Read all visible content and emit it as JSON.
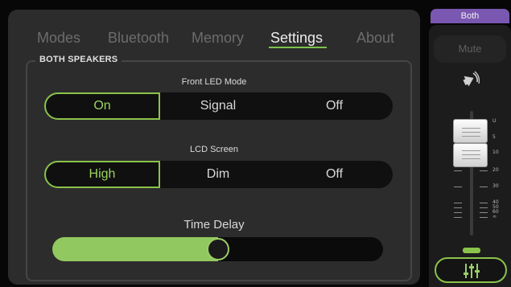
{
  "tabs": [
    {
      "label": "Modes",
      "active": false
    },
    {
      "label": "Bluetooth",
      "active": false
    },
    {
      "label": "Memory",
      "active": false
    },
    {
      "label": "Settings",
      "active": true
    },
    {
      "label": "About",
      "active": false
    }
  ],
  "group_title": "BOTH SPEAKERS",
  "front_led": {
    "label": "Front LED Mode",
    "options": [
      "On",
      "Signal",
      "Off"
    ],
    "selected": "On"
  },
  "lcd_screen": {
    "label": "LCD Screen",
    "options": [
      "High",
      "Dim",
      "Off"
    ],
    "selected": "High"
  },
  "time_delay": {
    "label": "Time Delay",
    "value_fraction": 0.5
  },
  "channel_strip": {
    "target_label": "Both",
    "mute_label": "Mute",
    "fader_scale": [
      "U",
      "5",
      "10",
      "20",
      "30",
      "40",
      "50",
      "60",
      "∞"
    ],
    "icons": {
      "speaker": "speaker-volume-icon",
      "mixer": "mixer-sliders-icon"
    }
  },
  "colors": {
    "accent": "#8bc34a",
    "purple_tab": "#7a57b0",
    "panel": "#2c2c2c",
    "background": "#070707"
  }
}
